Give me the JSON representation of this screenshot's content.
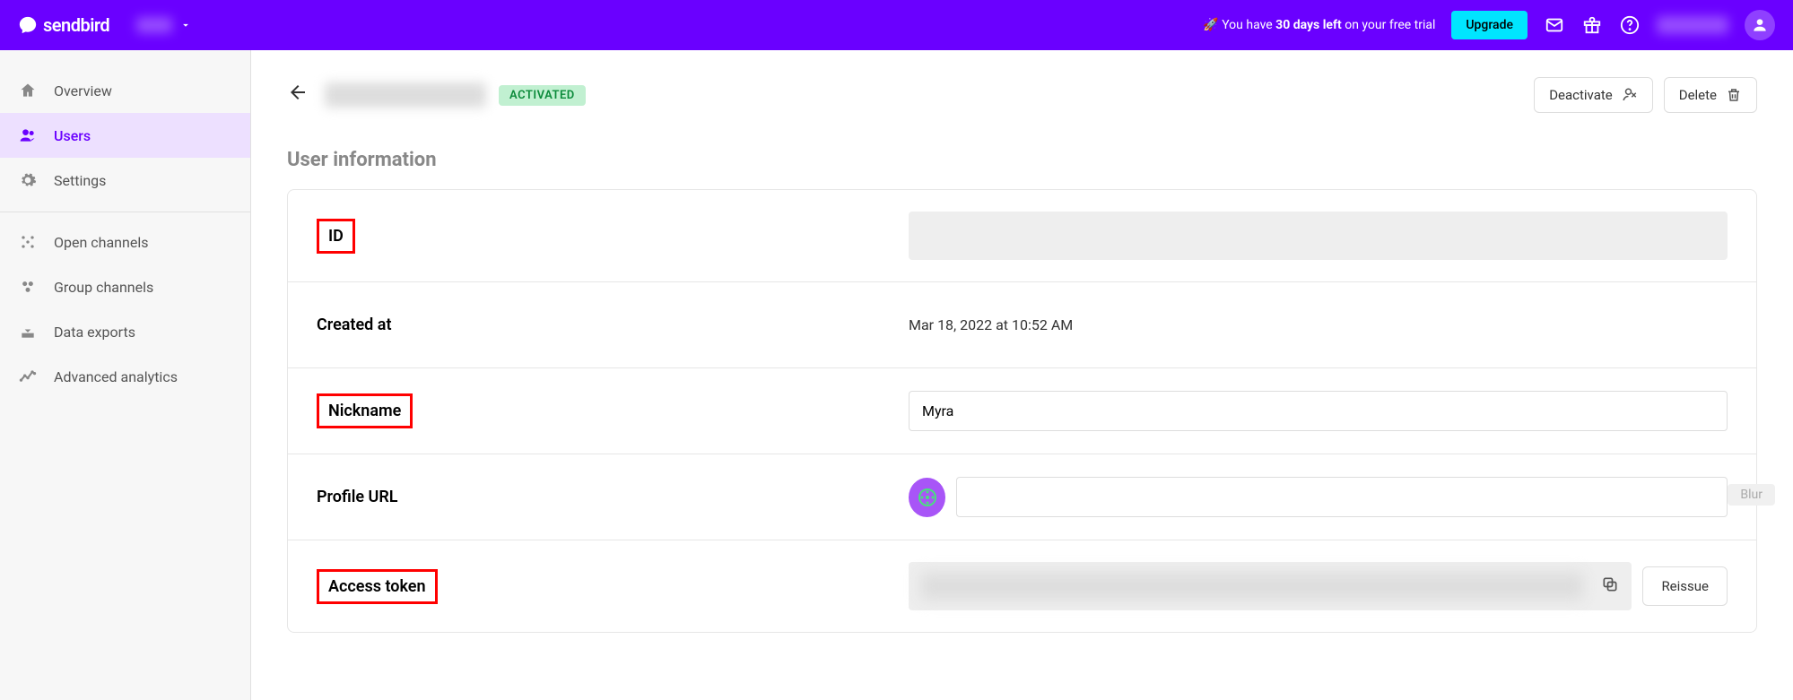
{
  "header": {
    "brand": "sendbird",
    "trial_prefix": "🚀 You have ",
    "trial_days": "30 days left ",
    "trial_suffix": "on your free trial",
    "upgrade": "Upgrade"
  },
  "sidebar": {
    "overview": "Overview",
    "users": "Users",
    "settings": "Settings",
    "open_channels": "Open channels",
    "group_channels": "Group channels",
    "data_exports": "Data exports",
    "advanced_analytics": "Advanced analytics"
  },
  "page": {
    "status": "ACTIVATED",
    "deactivate": "Deactivate",
    "delete": "Delete",
    "section_title": "User information",
    "blur_label": "Blur"
  },
  "fields": {
    "id": "ID",
    "created_at": "Created at",
    "created_at_value": "Mar 18, 2022 at 10:52 AM",
    "nickname": "Nickname",
    "nickname_value": "Myra",
    "profile_url": "Profile URL",
    "profile_url_value": "",
    "access_token": "Access token",
    "reissue": "Reissue"
  }
}
